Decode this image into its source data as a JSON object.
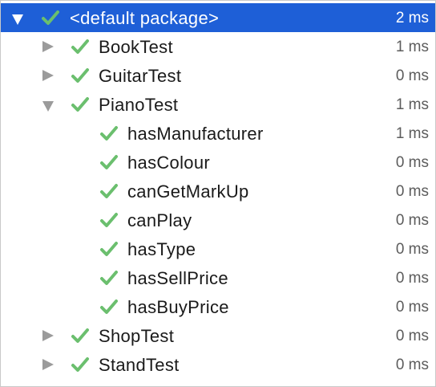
{
  "colors": {
    "selection": "#1e5fd7",
    "check": "#6bbf6e",
    "arrow": "#9b9b9b"
  },
  "rows": [
    {
      "label": "<default package>",
      "time": "2 ms",
      "arrow": "expanded",
      "selected": true
    },
    {
      "label": "BookTest",
      "time": "1 ms",
      "arrow": "collapsed"
    },
    {
      "label": "GuitarTest",
      "time": "0 ms",
      "arrow": "collapsed"
    },
    {
      "label": "PianoTest",
      "time": "1 ms",
      "arrow": "expanded"
    },
    {
      "label": "hasManufacturer",
      "time": "1 ms"
    },
    {
      "label": "hasColour",
      "time": "0 ms"
    },
    {
      "label": "canGetMarkUp",
      "time": "0 ms"
    },
    {
      "label": "canPlay",
      "time": "0 ms"
    },
    {
      "label": "hasType",
      "time": "0 ms"
    },
    {
      "label": "hasSellPrice",
      "time": "0 ms"
    },
    {
      "label": "hasBuyPrice",
      "time": "0 ms"
    },
    {
      "label": "ShopTest",
      "time": "0 ms",
      "arrow": "collapsed"
    },
    {
      "label": "StandTest",
      "time": "0 ms",
      "arrow": "collapsed"
    }
  ]
}
